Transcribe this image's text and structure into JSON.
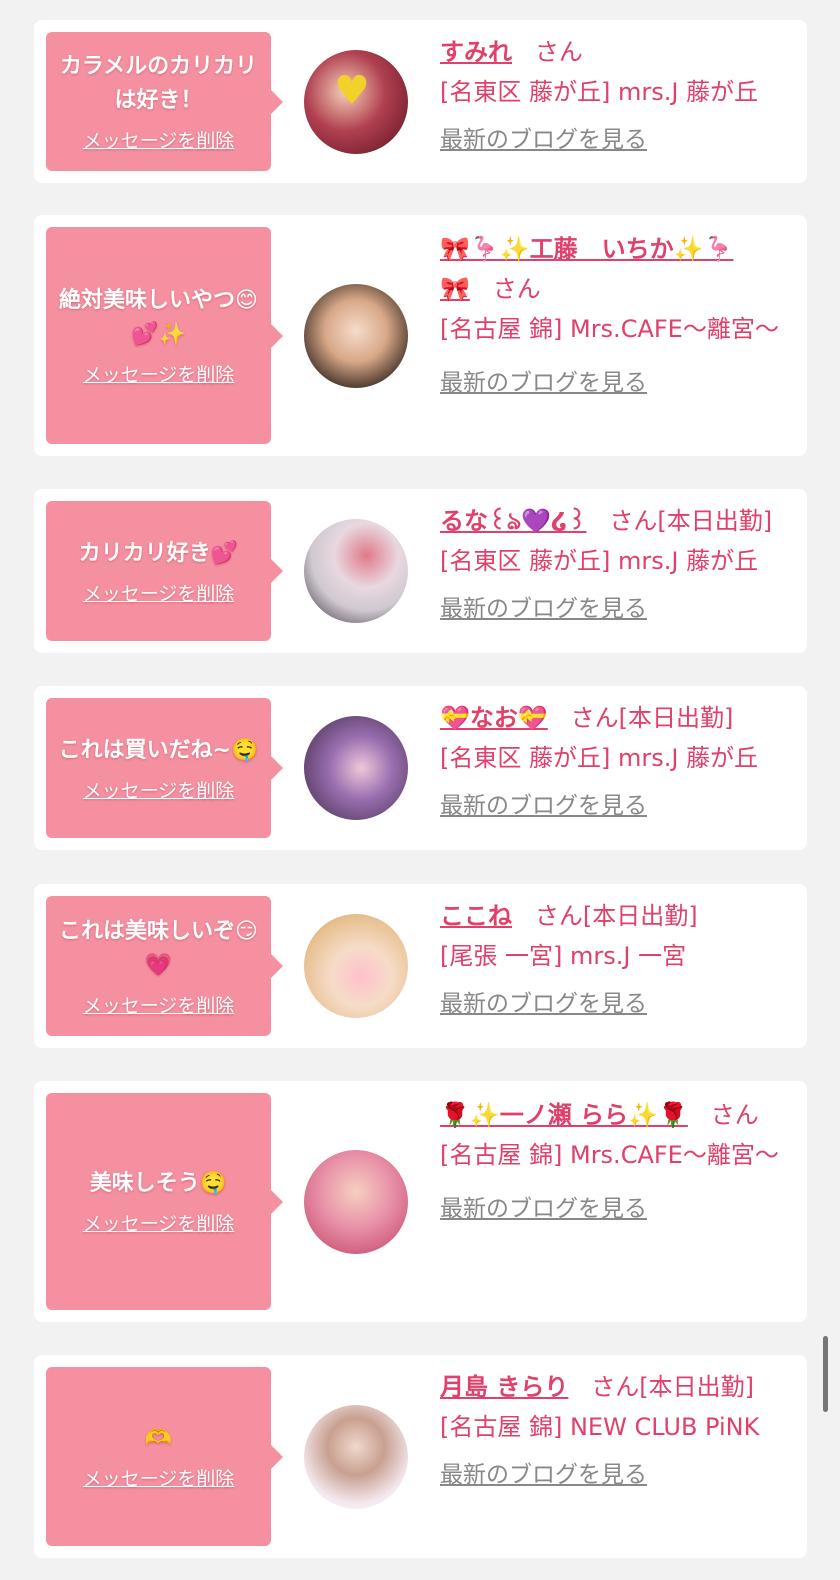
{
  "delete_label": "メッセージを削除",
  "blog_label": "最新のブログを見る",
  "suffix": "さん",
  "items": [
    {
      "message": "カラメルのカリカリは好き！",
      "name": "すみれ",
      "status": "",
      "shop": "[名東区 藤が丘] mrs.J 藤が丘"
    },
    {
      "message": "絶対美味しいやつ😊💕✨",
      "name": "🎀🦩✨工藤　いちか✨🦩🎀",
      "status": "",
      "shop": "[名古屋 錦] Mrs.CAFE～離宮～"
    },
    {
      "message": "カリカリ好き💕",
      "name": "るな꒰ঌ💜໒꒱",
      "status": "[本日出勤]",
      "shop": "[名東区 藤が丘] mrs.J 藤が丘"
    },
    {
      "message": "これは買いだね~🤤",
      "name": "💝なお💝",
      "status": "[本日出勤]",
      "shop": "[名東区 藤が丘] mrs.J 藤が丘"
    },
    {
      "message": "これは美味しいぞ😏💗",
      "name": "ここね",
      "status": "[本日出勤]",
      "shop": "[尾張 一宮] mrs.J 一宮"
    },
    {
      "message": "美味しそう🤤",
      "name": "🌹✨一ノ瀬 らら✨🌹",
      "status": "",
      "shop": "[名古屋 錦] Mrs.CAFE～離宮～"
    },
    {
      "message": "🫶",
      "name": "月島 きらり",
      "status": "[本日出勤]",
      "shop": "[名古屋 錦] NEW CLUB PiNK"
    }
  ]
}
